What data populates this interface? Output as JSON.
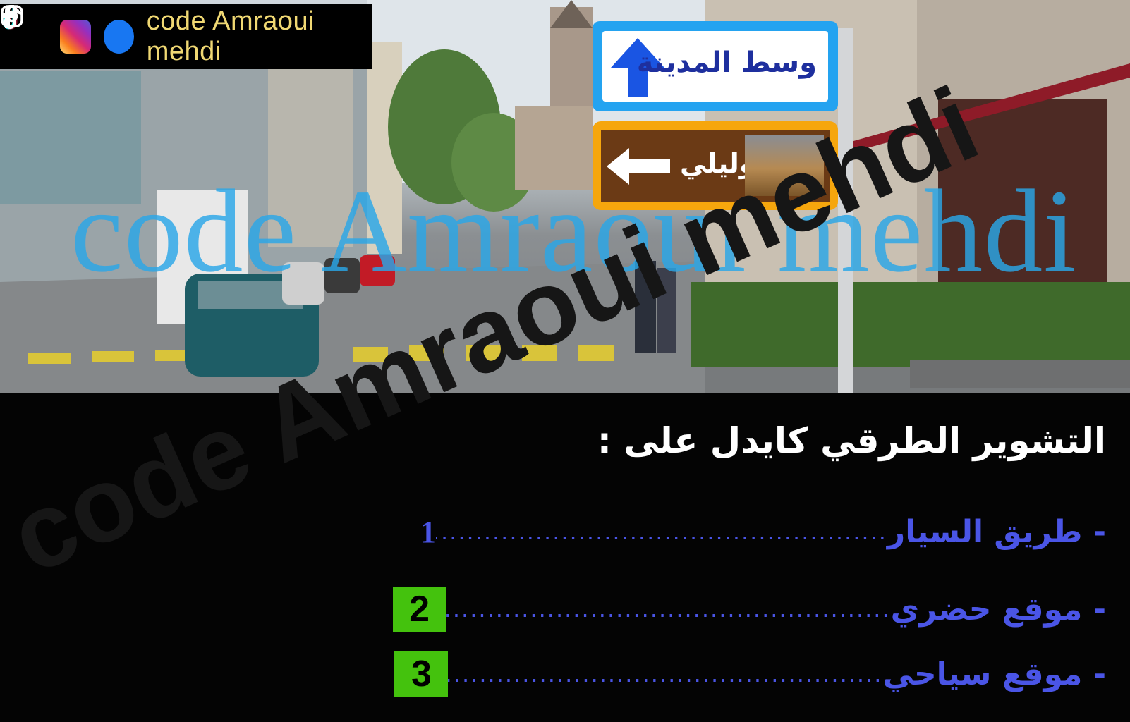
{
  "header": {
    "handle": "code Amraoui mehdi",
    "icons": [
      "tiktok-icon",
      "instagram-icon",
      "facebook-icon"
    ]
  },
  "scene": {
    "watermark": "code Amraoui mehdi",
    "sign_city_label": "وسط المدينة",
    "sign_volubilis_label": "وليلي"
  },
  "question": {
    "text": "التشوير الطرقي كايدل على :",
    "options": [
      {
        "label": "- طريق السيار",
        "number": "1"
      },
      {
        "label": "- موقع حضري",
        "number": "2"
      },
      {
        "label": "- موقع سياحي",
        "number": "3"
      }
    ]
  },
  "colors": {
    "option_text": "#4a55e6",
    "answer_box": "#44c20d",
    "sign_city_border": "#24a3f0",
    "sign_volubilis_border": "#f6a60d"
  }
}
